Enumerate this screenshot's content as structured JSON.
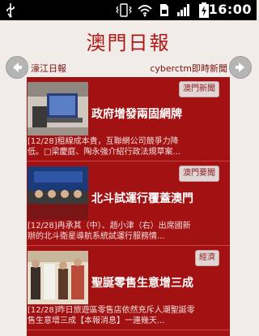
{
  "status_bar": {
    "time": "16:00",
    "icons": [
      "usb-icon",
      "vibrate-icon",
      "wifi-icon",
      "sim-icon",
      "signal-icon",
      "battery-charging-icon"
    ]
  },
  "header": {
    "title": "澳門日報",
    "prev_label": "濠江日報",
    "next_label": "cyberctm即時新聞"
  },
  "news": [
    {
      "category": "澳門新聞",
      "headline": "政府增發兩固網牌",
      "date": "[12/28]",
      "snippet_line1": "租線成本貴，互聯網公司競爭力降",
      "snippet_line2": "低。□梁慶庭、陶永強介紹行政法規草案..."
    },
    {
      "category": "澳門要聞",
      "headline": "北斗試運行覆蓋澳門",
      "date": "[12/28]",
      "snippet_line1": "冉承其（中）、趙小津（右）出席國新",
      "snippet_line2": "辦的北斗衛星導航系統試運行服務情..."
    },
    {
      "category": "經濟",
      "headline": "聖誕零售生意增三成",
      "date": "[12/28]",
      "snippet_line1": "昨日旅遊區零售店依然充斥人潮聖誕零",
      "snippet_line2": "售生意增三成【本報消息】一連幾天..."
    }
  ],
  "colors": {
    "brand_red": "#a31212",
    "title_red": "#b01818",
    "background": "#f1ece7"
  }
}
